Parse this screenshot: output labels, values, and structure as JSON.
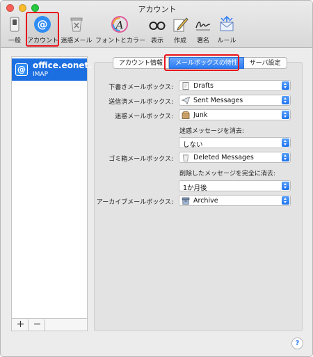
{
  "window": {
    "title": "アカウント"
  },
  "toolbar": {
    "items": [
      {
        "label": "一般",
        "icon": "switch-icon"
      },
      {
        "label": "アカウント",
        "icon": "at-icon",
        "selected": true
      },
      {
        "label": "迷惑メール",
        "icon": "trash-x-icon"
      },
      {
        "label": "フォントとカラー",
        "icon": "font-color-icon"
      },
      {
        "label": "表示",
        "icon": "glasses-icon"
      },
      {
        "label": "作成",
        "icon": "compose-pencil-icon"
      },
      {
        "label": "署名",
        "icon": "signature-icon"
      },
      {
        "label": "ルール",
        "icon": "rules-envelope-icon"
      }
    ]
  },
  "sidebar": {
    "account": {
      "name": "office.eonet.",
      "type": "IMAP",
      "icon": "@"
    },
    "add_label": "+",
    "remove_label": "−"
  },
  "tabs": [
    {
      "label": "アカウント情報",
      "active": false
    },
    {
      "label": "メールボックスの特性",
      "active": true
    },
    {
      "label": "サーバ設定",
      "active": false
    }
  ],
  "form": {
    "drafts": {
      "label": "下書きメールボックス:",
      "value": "Drafts"
    },
    "sent": {
      "label": "送信済メールボックス:",
      "value": "Sent Messages"
    },
    "junk": {
      "label": "迷惑メールボックス:",
      "value": "Junk"
    },
    "junk_delete": {
      "label": "迷惑メッセージを消去:",
      "value": "しない"
    },
    "trash": {
      "label": "ゴミ箱メールボックス:",
      "value": "Deleted Messages"
    },
    "trash_delete": {
      "label": "削除したメッセージを完全に消去:",
      "value": "1か月後"
    },
    "archive": {
      "label": "アーカイブメールボックス:",
      "value": "Archive"
    }
  },
  "help": {
    "label": "?"
  },
  "colors": {
    "accent": "#2b7bf3",
    "highlight": "#e8121a",
    "selection": "#1c6fe0"
  }
}
